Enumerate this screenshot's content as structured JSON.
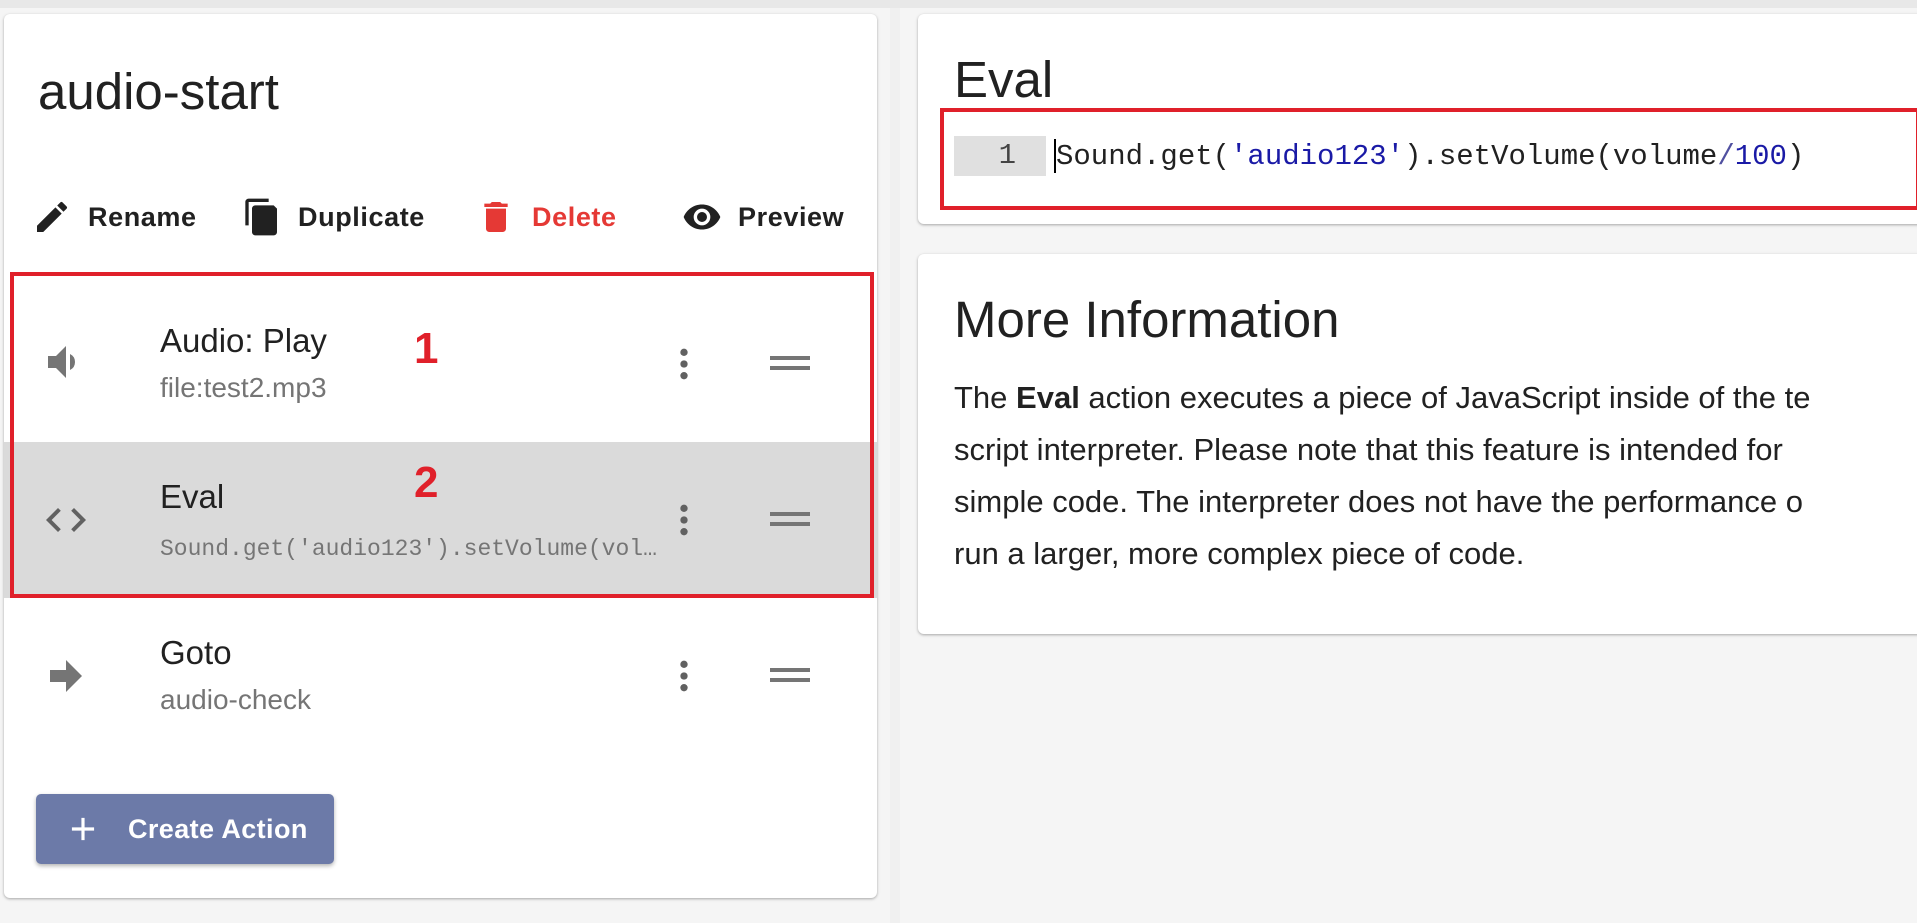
{
  "left": {
    "title": "audio-start",
    "toolbar": {
      "rename": "Rename",
      "duplicate": "Duplicate",
      "delete": "Delete",
      "preview": "Preview"
    },
    "actions": [
      {
        "title": "Audio: Play",
        "subtitle": "file:test2.mp3",
        "icon": "volume-icon",
        "annotation": "1"
      },
      {
        "title": "Eval",
        "subtitle": "Sound.get('audio123').setVolume(volume/100)",
        "icon": "code-icon",
        "annotation": "2"
      },
      {
        "title": "Goto",
        "subtitle": "audio-check",
        "icon": "arrow-right-icon"
      }
    ],
    "create_button": "Create Action"
  },
  "eval": {
    "title": "Eval",
    "line_number": "1",
    "code": {
      "t1": "Sound.get(",
      "t2": "'audio123'",
      "t3": ").setVolume(volume",
      "t4": "/",
      "t5": "100",
      "t6": ")"
    }
  },
  "info": {
    "title": "More Information",
    "lines": {
      "l1_pre": "The ",
      "l1_bold": "Eval",
      "l1_post": " action executes a piece of JavaScript inside of the te",
      "l2": "script interpreter. Please note that this feature is intended for",
      "l3": "simple code. The interpreter does not have the performance o",
      "l4": "run a larger, more complex piece of code."
    }
  },
  "colors": {
    "accent_button": "#6c7aa8",
    "danger": "#e53935",
    "annotation": "#e0202a",
    "selected_row": "#dadada"
  }
}
